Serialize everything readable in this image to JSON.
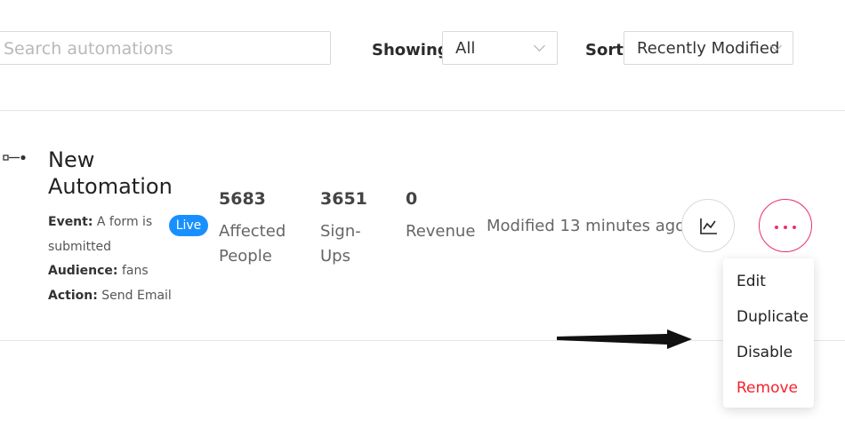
{
  "toolbar": {
    "search_placeholder": "Search automations",
    "showing_label": "Showing",
    "showing_value": "All",
    "sort_label": "Sort",
    "sort_value": "Recently Modified"
  },
  "automation": {
    "name_line1": "New",
    "name_line2": "Automation",
    "status": "Live",
    "event_label": "Event:",
    "event_value": "A form is",
    "event_value_cont": "submitted",
    "audience_label": "Audience:",
    "audience_value": "fans",
    "action_label": "Action:",
    "action_value": "Send Email",
    "stats": [
      {
        "value": "5683",
        "label_line1": "Affected",
        "label_line2": "People"
      },
      {
        "value": "3651",
        "label_line1": "Sign-",
        "label_line2": "Ups"
      },
      {
        "value": "0",
        "label_line1": "Revenue",
        "label_line2": ""
      }
    ],
    "modified": "Modified 13 minutes ago"
  },
  "menu": {
    "items": [
      "Edit",
      "Duplicate",
      "Disable",
      "Remove"
    ],
    "remove_color": "#f5222d"
  },
  "icons": {
    "drag": "drag-handle-icon",
    "chart": "chart-line-icon",
    "more": "more-dots-icon"
  },
  "colors": {
    "accent_blue": "#1890ff",
    "accent_pink": "#eb2f6b"
  }
}
